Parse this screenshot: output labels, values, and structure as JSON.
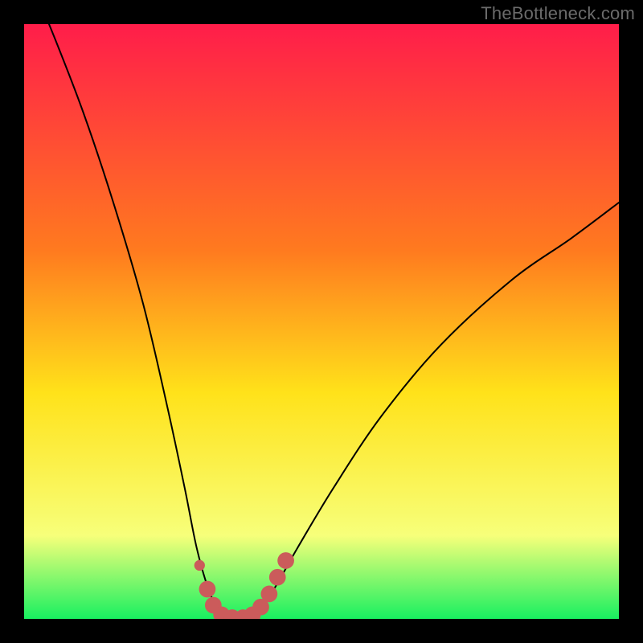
{
  "watermark": "TheBottleneck.com",
  "colors": {
    "background": "#000000",
    "gradient_top": "#ff1d4a",
    "gradient_mid1": "#ff7a1f",
    "gradient_mid2": "#ffe21a",
    "gradient_mid3": "#f7ff7a",
    "gradient_bottom": "#18f060",
    "curve": "#000000",
    "marker": "#cb5b5b"
  },
  "chart_data": {
    "type": "line",
    "title": "",
    "xlabel": "",
    "ylabel": "",
    "xlim": [
      0,
      100
    ],
    "ylim": [
      0,
      100
    ],
    "series": [
      {
        "name": "bottleneck-curve",
        "x": [
          0,
          5,
          10,
          15,
          20,
          24,
          27,
          29,
          31,
          33,
          35,
          37,
          39,
          42,
          46,
          52,
          60,
          70,
          82,
          92,
          100
        ],
        "y": [
          110,
          98,
          85,
          70,
          53,
          36,
          22,
          12,
          5,
          1,
          0,
          0,
          1,
          5,
          12,
          22,
          34,
          46,
          57,
          64,
          70
        ]
      }
    ],
    "markers": [
      {
        "name": "marker-left-dot",
        "x": 29.5,
        "y": 9
      },
      {
        "name": "marker-u-left-1",
        "x": 30.8,
        "y": 5
      },
      {
        "name": "marker-u-left-2",
        "x": 31.8,
        "y": 2.3
      },
      {
        "name": "marker-u-bottom-1",
        "x": 33.2,
        "y": 0.7
      },
      {
        "name": "marker-u-bottom-2",
        "x": 35.0,
        "y": 0.2
      },
      {
        "name": "marker-u-bottom-3",
        "x": 36.8,
        "y": 0.2
      },
      {
        "name": "marker-u-bottom-4",
        "x": 38.4,
        "y": 0.7
      },
      {
        "name": "marker-u-right-1",
        "x": 39.8,
        "y": 2.0
      },
      {
        "name": "marker-u-right-2",
        "x": 41.2,
        "y": 4.2
      },
      {
        "name": "marker-u-right-3",
        "x": 42.6,
        "y": 7.0
      },
      {
        "name": "marker-u-right-4",
        "x": 44.0,
        "y": 9.8
      }
    ],
    "marker_radius_big": 1.4,
    "marker_radius_small": 0.9
  }
}
